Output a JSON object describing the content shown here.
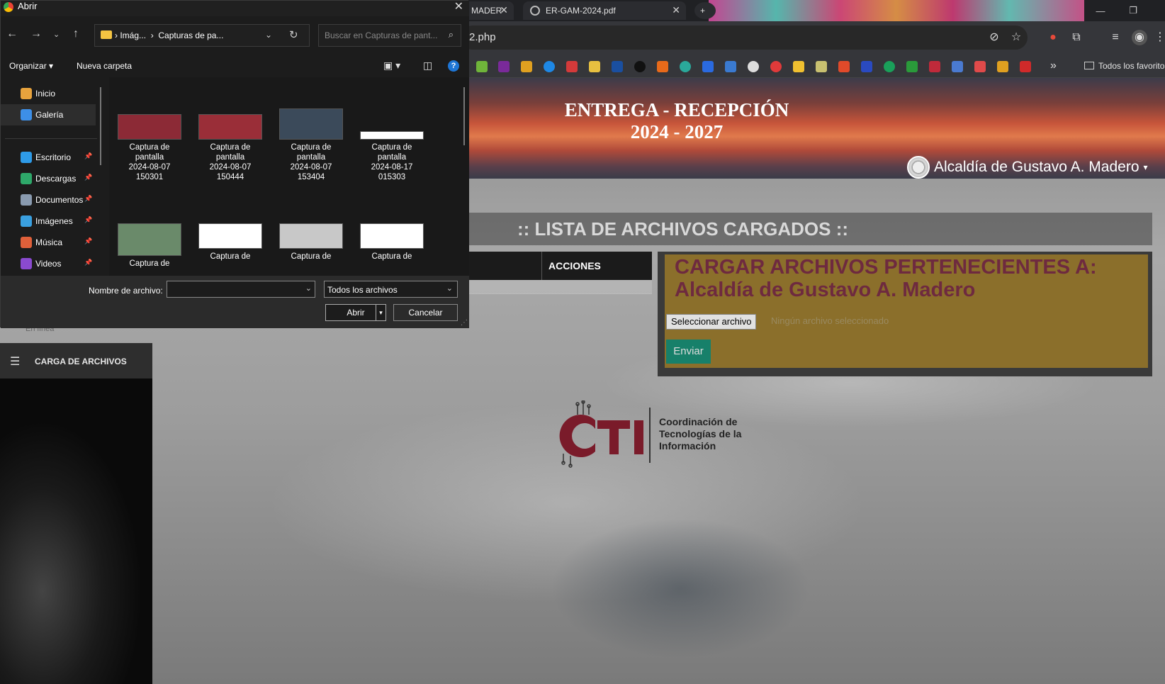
{
  "browser": {
    "tabs": [
      {
        "title": "MADER"
      },
      {
        "title": "ER-GAM-2024.pdf"
      }
    ],
    "new_tab": "+",
    "url": "2.php",
    "bookmarks_more": "»",
    "bookmarks_folder": "Todos los favoritos"
  },
  "page": {
    "banner_title_line1": "ENTREGA - RECEPCIÓN",
    "banner_title_line2": "2024 - 2027",
    "user_menu": "Alcaldía de Gustavo A. Madero",
    "user_caret": "▾",
    "lista_title": ":: LISTA DE ARCHIVOS CARGADOS ::",
    "table_header_acciones": "ACCIONES",
    "upload_title": "CARGAR ARCHIVOS PERTENECIENTES A: Alcaldía de Gustavo A. Madero",
    "file_button": "Seleccionar archivo",
    "file_status": "Ningún archivo seleccionado",
    "send_button": "Enviar",
    "cti_line1": "Coordinación de",
    "cti_line2": "Tecnologías de la",
    "cti_line3": "Información",
    "sidebar_carga": "CARGA DE ARCHIVOS",
    "sidebar_status": "En línea"
  },
  "dialog": {
    "title": "Abrir",
    "breadcrumb": [
      "Imág...",
      "Capturas de pa..."
    ],
    "search_placeholder": "Buscar en Capturas de pant...",
    "organizar": "Organizar",
    "nueva_carpeta": "Nueva carpeta",
    "nav": [
      {
        "label": "Inicio",
        "icon": "home-icon",
        "color": "#e8a33d",
        "pinned": false
      },
      {
        "label": "Galería",
        "icon": "gallery-icon",
        "color": "#3d8fe8",
        "pinned": false
      },
      {
        "label": "Escritorio",
        "icon": "desktop-icon",
        "color": "#2e9be8",
        "pinned": true
      },
      {
        "label": "Descargas",
        "icon": "download-icon",
        "color": "#2ea86a",
        "pinned": true
      },
      {
        "label": "Documentos",
        "icon": "documents-icon",
        "color": "#8a9bb0",
        "pinned": true
      },
      {
        "label": "Imágenes",
        "icon": "pictures-icon",
        "color": "#3aa0e0",
        "pinned": true
      },
      {
        "label": "Música",
        "icon": "music-icon",
        "color": "#e0603a",
        "pinned": true
      },
      {
        "label": "Videos",
        "icon": "videos-icon",
        "color": "#8a4ad0",
        "pinned": true
      }
    ],
    "files": [
      {
        "l1": "Captura de",
        "l2": "pantalla",
        "l3": "2024-08-07",
        "l4": "150301",
        "thumb": "#8c2a36"
      },
      {
        "l1": "Captura de",
        "l2": "pantalla",
        "l3": "2024-08-07",
        "l4": "150444",
        "thumb": "#9a2e38"
      },
      {
        "l1": "Captura de",
        "l2": "pantalla",
        "l3": "2024-08-07",
        "l4": "153404",
        "thumb": "#3b4a5a"
      },
      {
        "l1": "Captura de",
        "l2": "pantalla",
        "l3": "2024-08-17",
        "l4": "015303",
        "thumb": "#ffffff"
      },
      {
        "l1": "Captura de",
        "thumb": "#6a8a6a"
      },
      {
        "l1": "Captura de",
        "thumb": "#ffffff"
      },
      {
        "l1": "Captura de",
        "thumb": "#c8c8c8"
      },
      {
        "l1": "Captura de",
        "thumb": "#ffffff"
      }
    ],
    "filename_label": "Nombre de archivo:",
    "filename_value": "",
    "type_value": "Todos los archivos",
    "open_button": "Abrir",
    "cancel_button": "Cancelar"
  },
  "colors": {
    "upload_bg": "#8b6f2b",
    "upload_title": "#6e2a3f",
    "send_button": "#17806a"
  }
}
